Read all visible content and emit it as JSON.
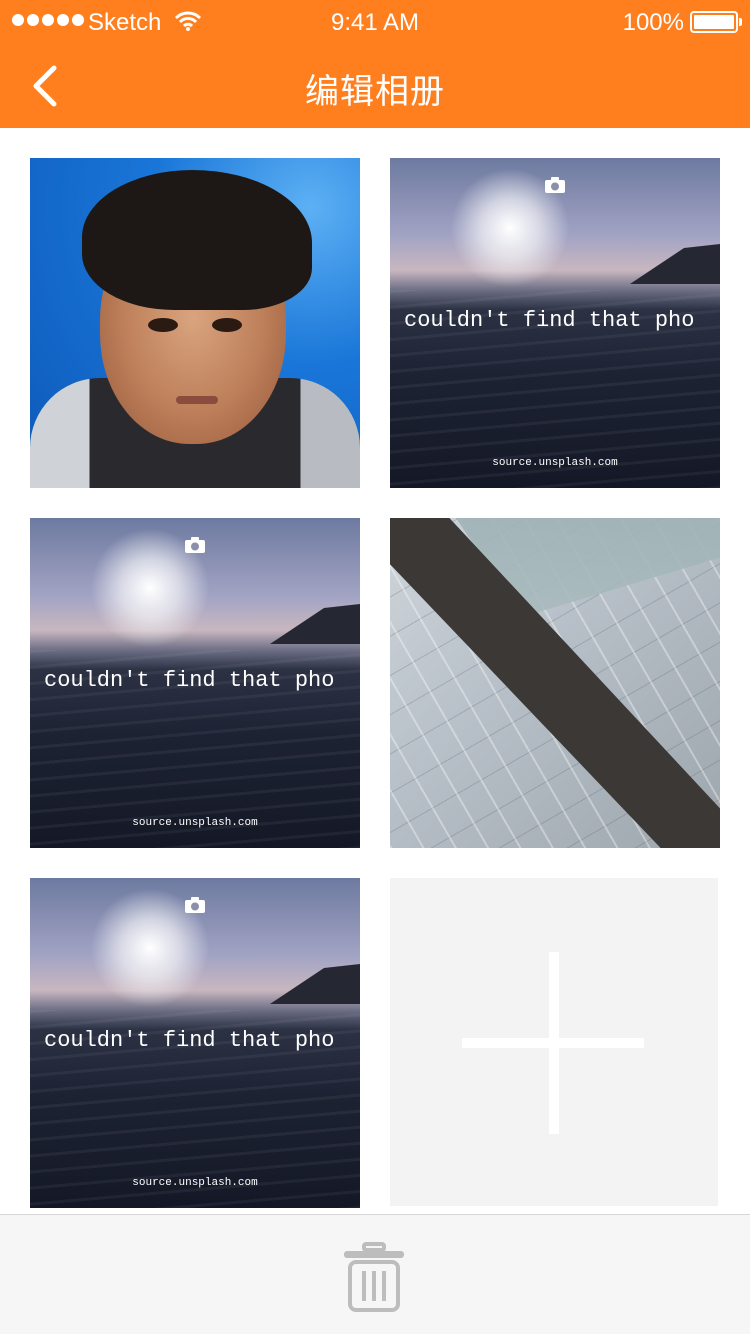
{
  "status_bar": {
    "carrier": "Sketch",
    "time": "9:41 AM",
    "battery": "100%",
    "signal_icon": "signal-dots-icon",
    "wifi_icon": "wifi-icon",
    "battery_icon": "battery-full-icon"
  },
  "nav": {
    "title": "编辑相册",
    "back_icon": "chevron-left-icon"
  },
  "colors": {
    "accent": "#ff7f1f",
    "add_tile": "#f3f3f3",
    "toolbar": "#f6f6f6",
    "trash_icon": "#bdbdbd"
  },
  "photos": [
    {
      "kind": "portrait-boy"
    },
    {
      "kind": "placeholder",
      "message": "couldn't find that pho",
      "source": "source.unsplash.com"
    },
    {
      "kind": "placeholder",
      "message": "couldn't find that pho",
      "source": "source.unsplash.com"
    },
    {
      "kind": "architecture"
    },
    {
      "kind": "placeholder",
      "message": "couldn't find that pho",
      "source": "source.unsplash.com"
    }
  ],
  "add_tile": {
    "icon": "plus-icon"
  },
  "toolbar": {
    "trash_icon": "trash-icon"
  }
}
